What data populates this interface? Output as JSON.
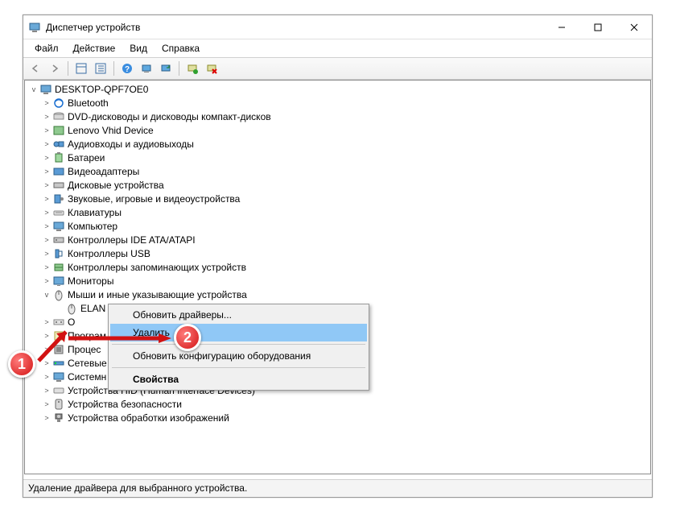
{
  "window": {
    "title": "Диспетчер устройств"
  },
  "menu": {
    "file": "Файл",
    "action": "Действие",
    "view": "Вид",
    "help": "Справка"
  },
  "tree": {
    "root": "DESKTOP-QPF7OE0",
    "items": [
      "Bluetooth",
      "DVD-дисководы и дисководы компакт-дисков",
      "Lenovo Vhid Device",
      "Аудиовходы и аудиовыходы",
      "Батареи",
      "Видеоадаптеры",
      "Дисковые устройства",
      "Звуковые, игровые и видеоустройства",
      "Клавиатуры",
      "Компьютер",
      "Контроллеры IDE ATA/ATAPI",
      "Контроллеры USB",
      "Контроллеры запоминающих устройств",
      "Мониторы"
    ],
    "mice": "Мыши и иные указывающие устройства",
    "elan": "ELAN",
    "cut": [
      "О",
      "Програм",
      "Процес",
      "Сетевые",
      "Системн"
    ],
    "after": [
      "Устройства HID (Human Interface Devices)",
      "Устройства безопасности",
      "Устройства обработки изображений"
    ]
  },
  "context": {
    "update": "Обновить драйверы...",
    "remove": "Удалить",
    "scan": "Обновить конфигурацию оборудования",
    "props": "Свойства"
  },
  "status": "Удаление драйвера для выбранного устройства.",
  "markers": {
    "m1": "1",
    "m2": "2"
  }
}
